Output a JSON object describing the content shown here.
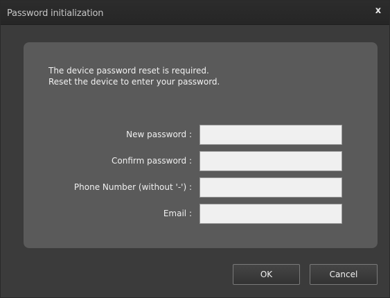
{
  "window": {
    "title": "Password initialization",
    "close_glyph": "x"
  },
  "notice": {
    "line1": "The device password reset is required.",
    "line2": "Reset the device to enter your password."
  },
  "form": {
    "new_password_label": "New password :",
    "new_password_value": "",
    "confirm_password_label": "Confirm password :",
    "confirm_password_value": "",
    "phone_label": "Phone Number (without '-') :",
    "phone_value": "",
    "email_label": "Email :",
    "email_value": ""
  },
  "buttons": {
    "ok_label": "OK",
    "cancel_label": "Cancel"
  },
  "colors": {
    "window_bg": "#3b3b3b",
    "panel_bg": "#5a5a5a",
    "input_bg": "#f0f0f0"
  }
}
